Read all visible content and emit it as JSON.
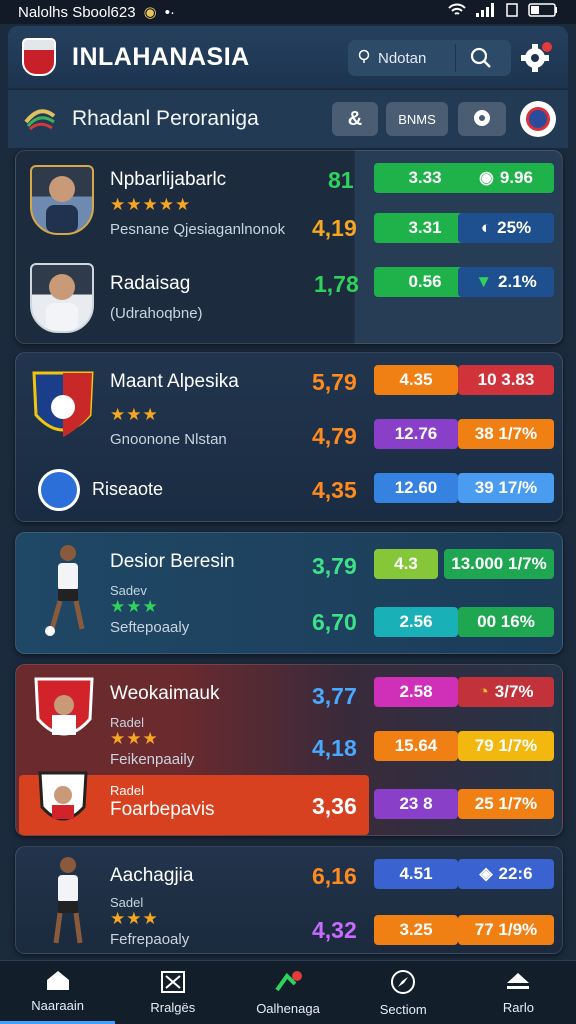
{
  "status_bar": {
    "left_text": "Nalolhs Sbool623"
  },
  "header": {
    "title": "INLAHANASIA",
    "search_value": "Ndotan"
  },
  "subheader": {
    "title": "Rhadanl Peroraniga",
    "tool_label": "BNMS"
  },
  "cards": [
    {
      "rows": [
        {
          "name": "Npbarlijabarlc",
          "stars": "★★★★★",
          "subtitle": "Pesnane Qjesiaganlnonok",
          "odd": "81",
          "odd_color": "#2fd35c",
          "pill1": "3.33",
          "pill2": "9.96"
        },
        {
          "odd": "4,19",
          "odd_color": "#f5a623",
          "pill1": "3.31",
          "pill2": "25%"
        },
        {
          "name": "Radaisag",
          "subtitle": "(Udrahoqbne)",
          "odd": "1,78",
          "odd_color": "#2fd35c",
          "pill1": "0.56",
          "pill2": "2.1%"
        }
      ]
    },
    {
      "rows": [
        {
          "name": "Maant Alpesika",
          "stars": "★★★",
          "subtitle": "Gnoonone Nlstan",
          "odd": "5,79",
          "odd_color": "#ff8a1e",
          "pill1": "4.35",
          "pill2": "10 3.83"
        },
        {
          "odd": "4,79",
          "odd_color": "#ff8a1e",
          "pill1": "12.76",
          "pill2": "38 1/7%"
        },
        {
          "name": "Riseaote",
          "odd": "4,35",
          "odd_color": "#ff8a1e",
          "pill1": "12.60",
          "pill2": "39 17/%"
        }
      ]
    },
    {
      "rows": [
        {
          "name": "Desior Beresin",
          "small": "Sadev",
          "stars": "★★★",
          "subtitle": "Seftepoaaly",
          "odd": "3,79",
          "odd_color": "#3fe08a",
          "pill1": "4.3",
          "pill2": "13.000 1/7%"
        },
        {
          "odd": "6,70",
          "odd_color": "#3fe08a",
          "pill1": "2.56",
          "pill2": "00 16%"
        }
      ]
    },
    {
      "rows": [
        {
          "name": "Weokaimauk",
          "small": "Radel",
          "stars": "★★★",
          "subtitle": "Feikenpaaily",
          "odd": "3,77",
          "odd_color": "#4aa8ff",
          "pill1": "2.58",
          "pill2": "3/7%"
        },
        {
          "odd": "4,18",
          "odd_color": "#4aa8ff",
          "pill1": "15.64",
          "pill2": "79 1/7%"
        },
        {
          "name": "Foarbepavis",
          "small": "Radel",
          "odd": "3,36",
          "odd_color": "#ffffff",
          "pill1": "23 8",
          "pill2": "25 1/7%"
        }
      ]
    },
    {
      "rows": [
        {
          "name": "Aachagjia",
          "small": "Sadel",
          "stars": "★★★",
          "subtitle": "Fefrepaoaly",
          "odd": "6,16",
          "odd_color": "#ff8a1e",
          "pill1": "4.51",
          "pill2": "22:6"
        },
        {
          "odd": "4,32",
          "odd_color": "#c86bff",
          "pill1": "3.25",
          "pill2": "77 1/9%"
        }
      ]
    }
  ],
  "nav": [
    "Naaraain",
    "Rralgës",
    "Oalhenaga",
    "Sectiom",
    "Rarlo"
  ]
}
